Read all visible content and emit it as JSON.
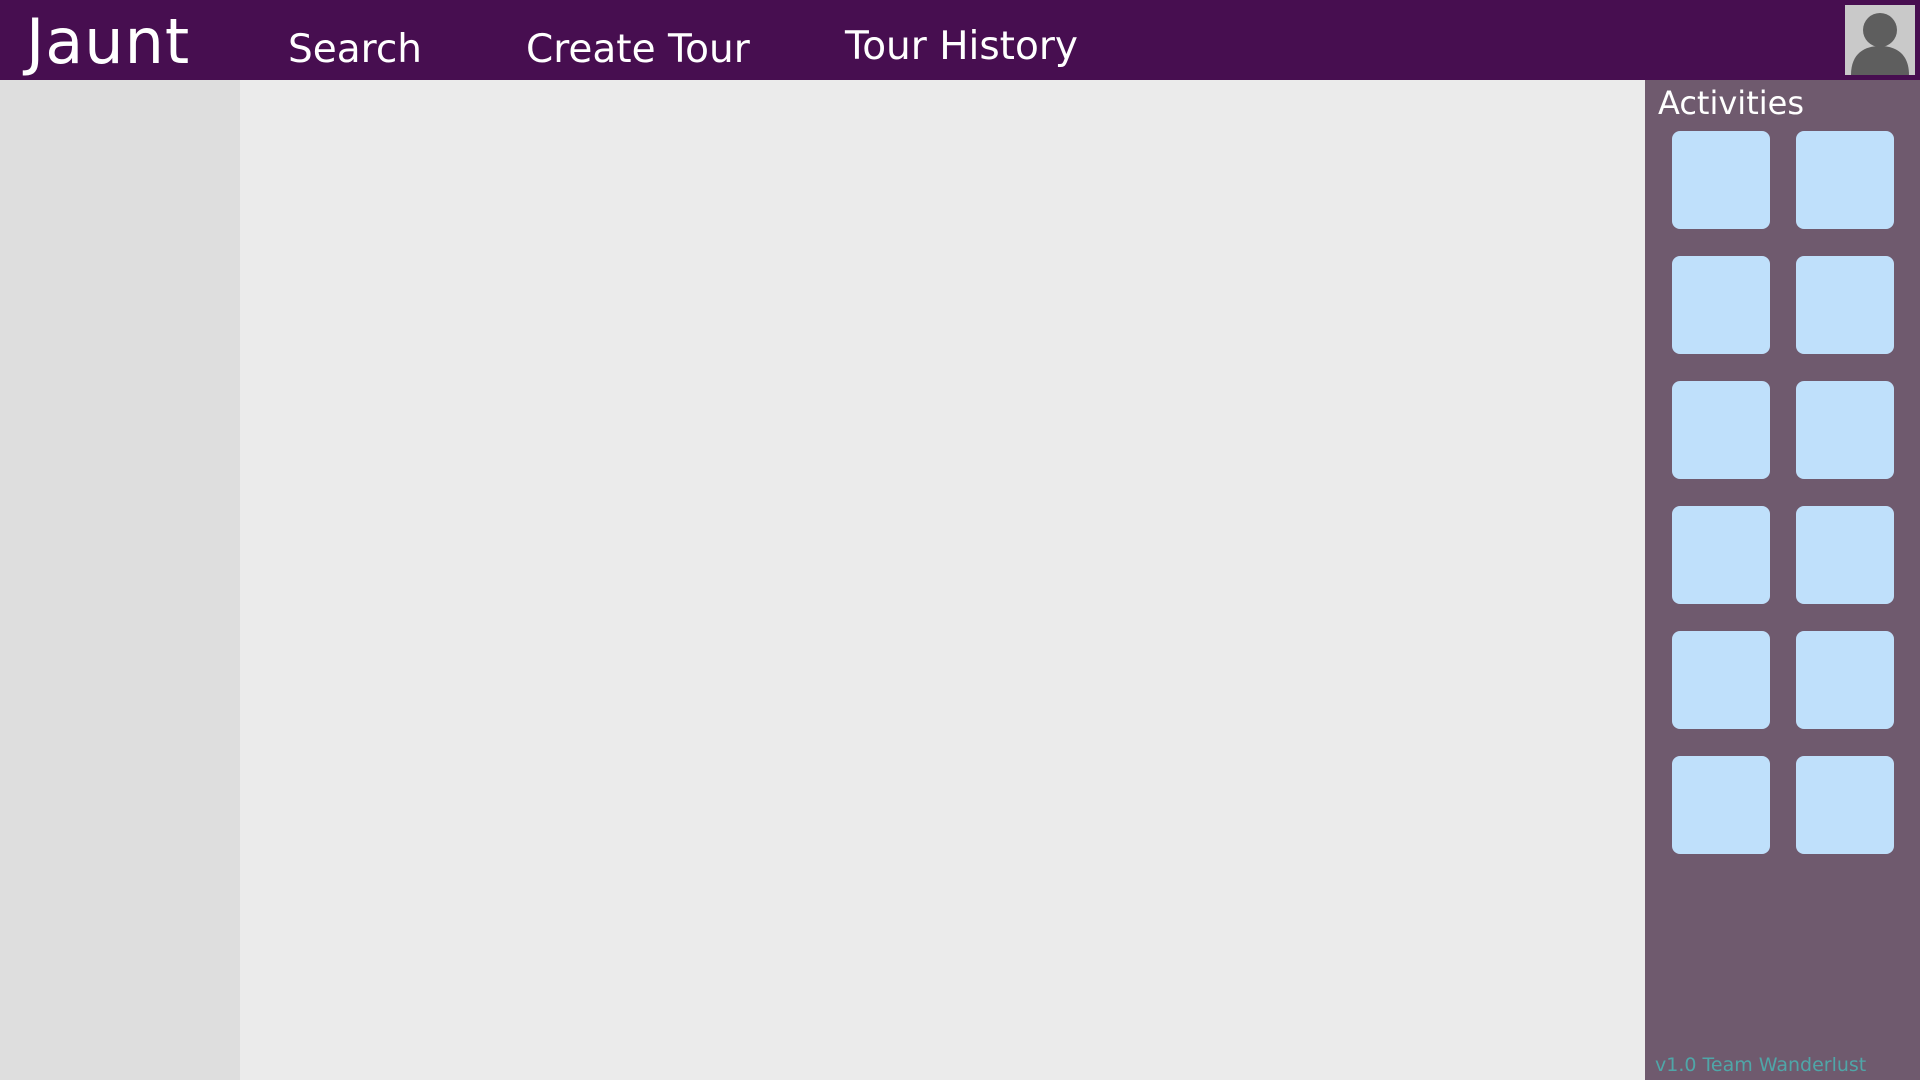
{
  "navbar": {
    "brand": "Jaunt",
    "links": [
      {
        "label": "Search"
      },
      {
        "label": "Create Tour"
      },
      {
        "label": "Tour History"
      }
    ],
    "avatar_icon": "user-silhouette-icon",
    "background_color": "#470e50"
  },
  "activities": {
    "title": "Activities",
    "tile_count": 12,
    "tile_color": "#bfe0fb",
    "panel_color": "#6f5a6e"
  },
  "footer": {
    "version_text": "v1.0 Team Wanderlust"
  }
}
